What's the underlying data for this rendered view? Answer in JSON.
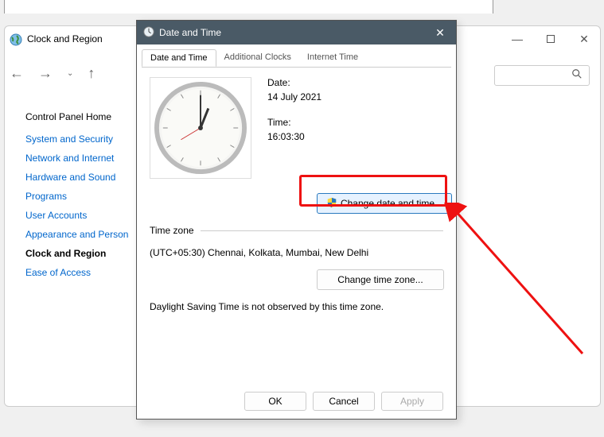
{
  "bg": {
    "wintitle": "Clock and Region",
    "side_head": "Control Panel Home",
    "side_items": [
      "System and Security",
      "Network and Internet",
      "Hardware and Sound",
      "Programs",
      "User Accounts",
      "Appearance and Personalization",
      "Clock and Region",
      "Ease of Access"
    ],
    "active_idx": 6
  },
  "dlg": {
    "title": "Date and Time",
    "tabs": [
      "Date and Time",
      "Additional Clocks",
      "Internet Time"
    ],
    "date_lbl": "Date:",
    "date_val": "14 July 2021",
    "time_lbl": "Time:",
    "time_val": "16:03:30",
    "change_dt": "Change date and time...",
    "tz_head": "Time zone",
    "tz_val": "(UTC+05:30) Chennai, Kolkata, Mumbai, New Delhi",
    "change_tz": "Change time zone...",
    "dst": "Daylight Saving Time is not observed by this time zone.",
    "ok": "OK",
    "cancel": "Cancel",
    "apply": "Apply"
  }
}
